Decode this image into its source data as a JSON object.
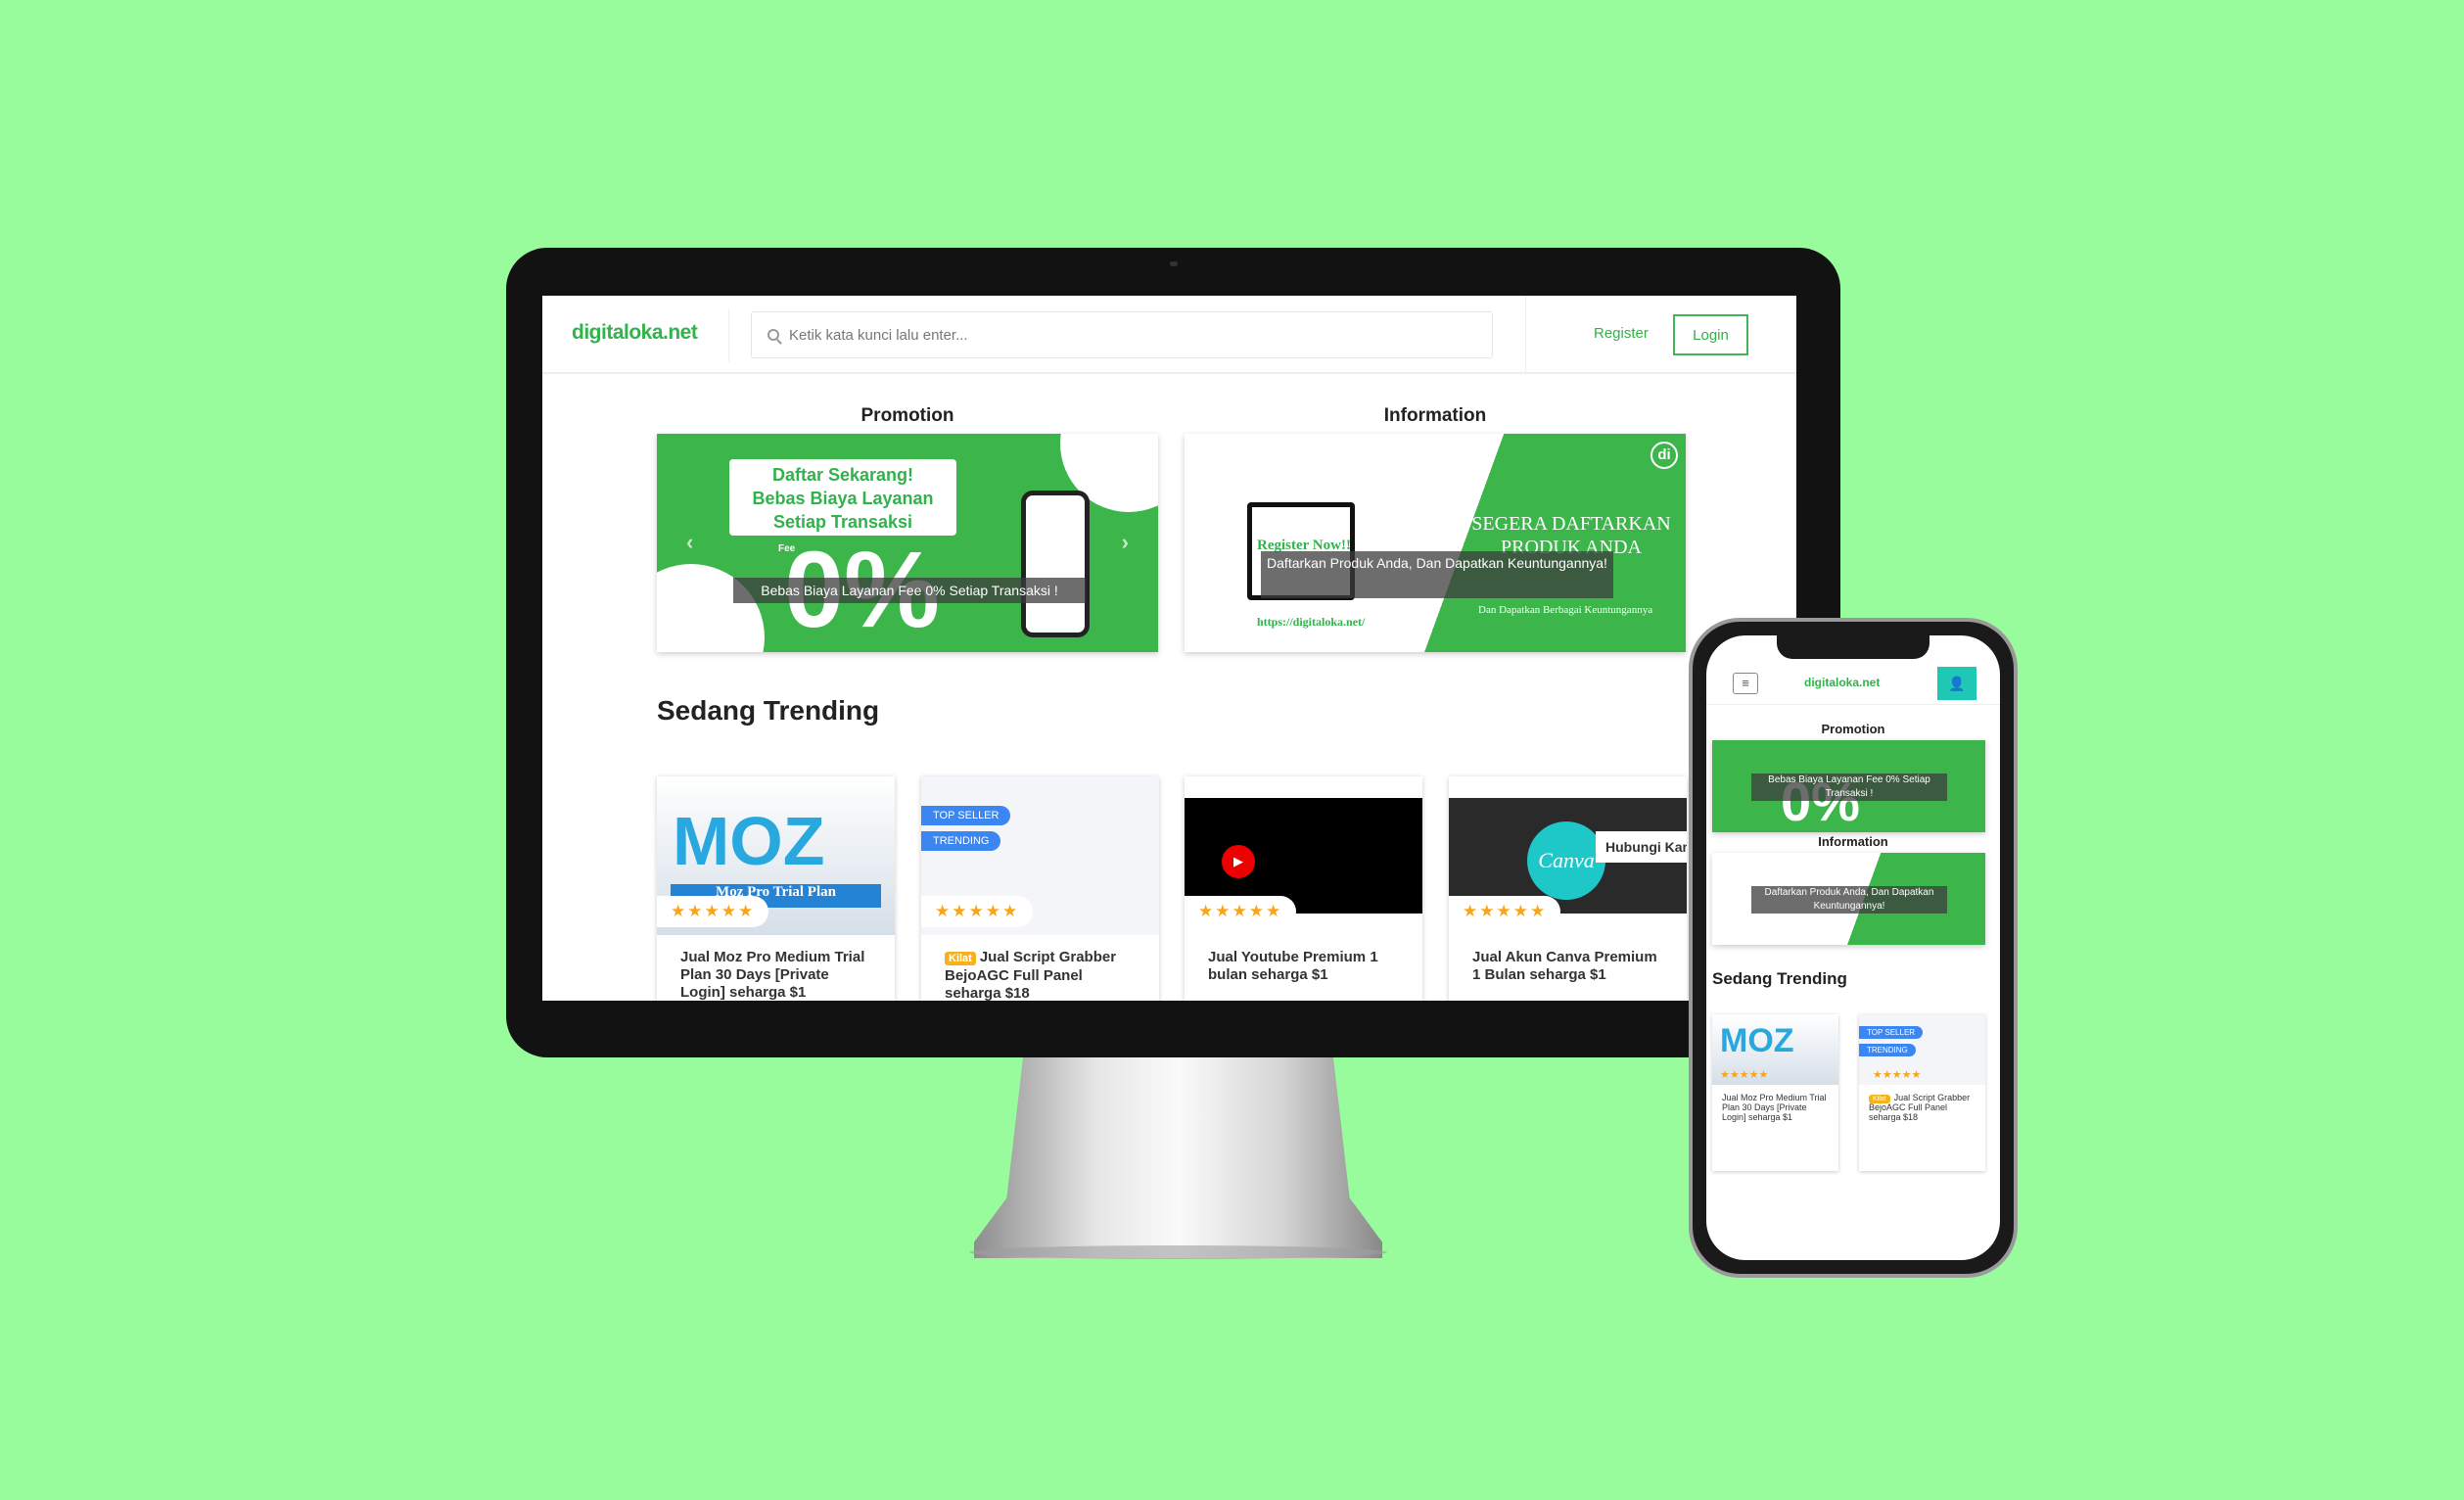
{
  "header": {
    "logo": "digitaloka.net",
    "search_placeholder": "Ketik kata kunci lalu enter...",
    "register": "Register",
    "login": "Login"
  },
  "promotion": {
    "title": "Promotion",
    "card_lines": [
      "Daftar Sekarang!",
      "Bebas Biaya Layanan",
      "Setiap Transaksi"
    ],
    "fee_label": "Fee",
    "big_text": "0%",
    "caption": "Bebas Biaya Layanan Fee 0% Setiap Transaksi !"
  },
  "information": {
    "title": "Information",
    "headline": "SEGERA DAFTARKAN PRODUK ANDA",
    "register_now": "Register Now!!",
    "url": "https://digitaloka.net/",
    "caption": "Daftarkan Produk Anda, Dan Dapatkan Keuntungannya!",
    "sub": "Dan Dapatkan Berbagai Keuntungannya"
  },
  "trending": {
    "title": "Sedang Trending",
    "stars": "★★★★★",
    "items": [
      {
        "title": "Jual Moz Pro Medium Trial Plan 30 Days [Private Login] seharga $1",
        "image_text": "MOZ",
        "ribbon": "Moz Pro Trial Plan"
      },
      {
        "badge": "Kilat",
        "title": "Jual Script Grabber BejoAGC Full Panel seharga $18",
        "tags": [
          "TOP SELLER",
          "TRENDING"
        ]
      },
      {
        "title": "Jual Youtube Premium 1 bulan seharga $1"
      },
      {
        "title": "Jual Akun Canva Premium 1 Bulan seharga $1",
        "image_text": "Canva",
        "contact": "Hubungi Kami"
      }
    ]
  },
  "colors": {
    "brand": "#3cb54a",
    "background": "#98fc9c",
    "accent_teal": "#1ec8b4"
  }
}
